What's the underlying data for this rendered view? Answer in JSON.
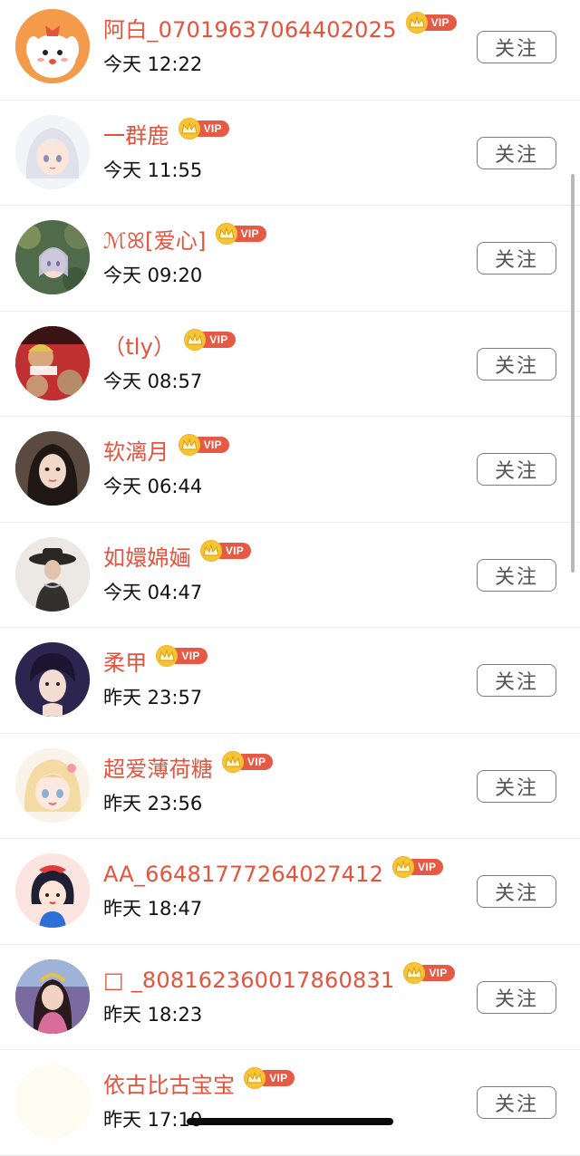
{
  "follow_label": "关注",
  "vip_label": "VIP",
  "colors": {
    "name": "#e5533d",
    "vip_tag": "#e65a45",
    "vip_crown": "#f7c436",
    "button_border": "#7d7d7d"
  },
  "users": [
    {
      "name": "阿白_07019637064402025",
      "time": "今天 12:22",
      "avatar": "cartoon-dog"
    },
    {
      "name": "一群鹿",
      "time": "今天 11:55",
      "avatar": "anime-girl-white-hair"
    },
    {
      "name": "ℳꕤ[爱心]",
      "time": "今天 09:20",
      "avatar": "anime-girl-forest"
    },
    {
      "name": "（tly）",
      "time": "今天 08:57",
      "avatar": "bts-photo"
    },
    {
      "name": "软漓月",
      "time": "今天 06:44",
      "avatar": "girl-portrait"
    },
    {
      "name": "如嬛婂婳",
      "time": "今天 04:47",
      "avatar": "woman-hat"
    },
    {
      "name": "柔甲",
      "time": "昨天 23:57",
      "avatar": "boy-portrait"
    },
    {
      "name": "超爱薄荷糖",
      "time": "昨天 23:56",
      "avatar": "anime-girl-blonde"
    },
    {
      "name": "AA_66481777264027412",
      "time": "昨天 18:47",
      "avatar": "snow-white-cartoon"
    },
    {
      "name": "□ _808162360017860831",
      "time": "昨天 18:23",
      "avatar": "game-character"
    },
    {
      "name": "依古比古宝宝",
      "time": "昨天 17:10",
      "avatar": "blank-pale"
    }
  ]
}
